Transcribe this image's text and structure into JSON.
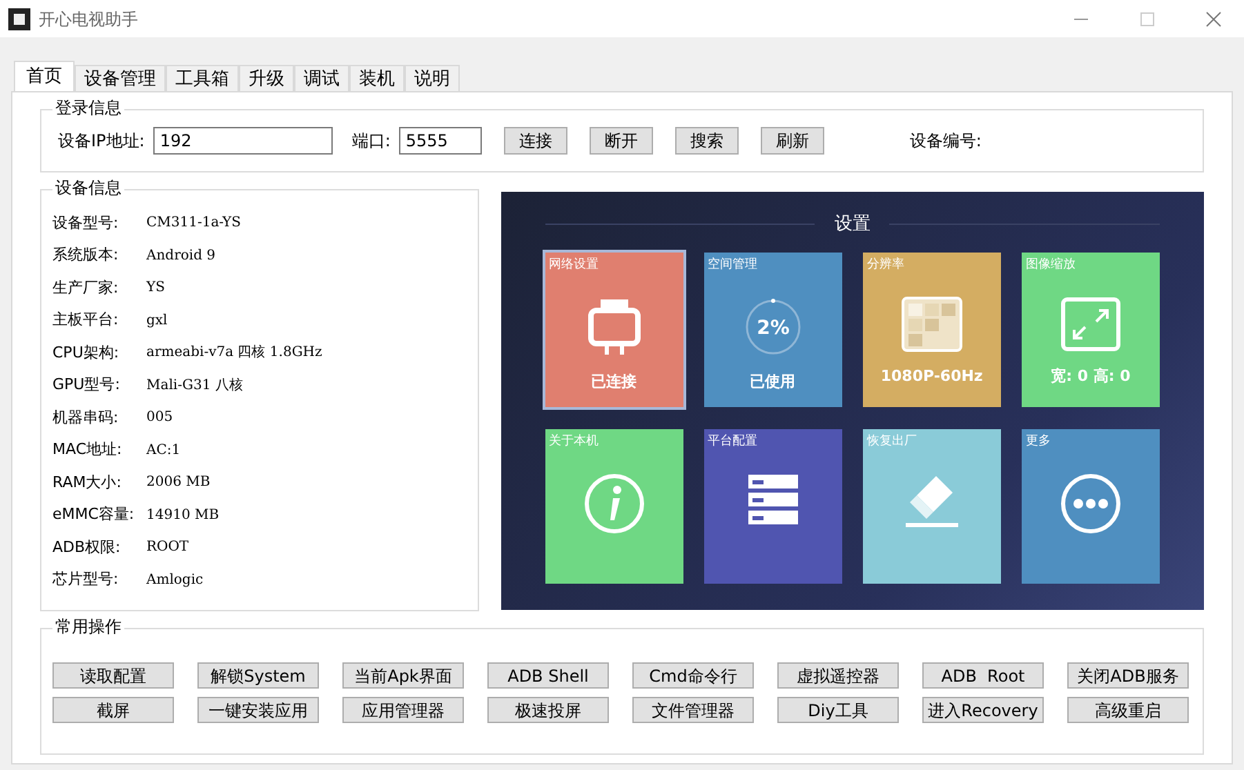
{
  "window": {
    "title": "开心电视助手"
  },
  "tabs": [
    {
      "label": "首页",
      "selected": true
    },
    {
      "label": "设备管理",
      "selected": false
    },
    {
      "label": "工具箱",
      "selected": false
    },
    {
      "label": "升级",
      "selected": false
    },
    {
      "label": "调试",
      "selected": false
    },
    {
      "label": "装机",
      "selected": false
    },
    {
      "label": "说明",
      "selected": false
    }
  ],
  "login": {
    "title": "登录信息",
    "ip_label": "设备IP地址:",
    "ip_value": "192",
    "port_label": "端口:",
    "port_value": "5555",
    "buttons": [
      "连接",
      "断开",
      "搜索",
      "刷新"
    ],
    "device_no_label": "设备编号:"
  },
  "device_info": {
    "title": "设备信息",
    "rows": [
      {
        "label": "设备型号:",
        "value": "CM311-1a-YS"
      },
      {
        "label": "系统版本:",
        "value": "Android 9"
      },
      {
        "label": "生产厂家:",
        "value": "YS"
      },
      {
        "label": "主板平台:",
        "value": "gxl"
      },
      {
        "label": "CPU架构:",
        "value": "armeabi-v7a 四核 1.8GHz"
      },
      {
        "label": "GPU型号:",
        "value": "Mali-G31 八核"
      },
      {
        "label": "机器串码:",
        "value": "005"
      },
      {
        "label": "MAC地址:",
        "value": "AC:1"
      },
      {
        "label": "RAM大小:",
        "value": "2006 MB"
      },
      {
        "label": "eMMC容量:",
        "value": "14910 MB"
      },
      {
        "label": "ADB权限:",
        "value": "ROOT"
      },
      {
        "label": "芯片型号:",
        "value": "Amlogic"
      }
    ]
  },
  "settings_screen": {
    "title": "设置",
    "tiles": [
      {
        "kind": "network",
        "label": "网络设置",
        "caption": "已连接",
        "color": "#e07f6f",
        "selected": true
      },
      {
        "kind": "storage",
        "label": "空间管理",
        "caption": "已使用",
        "gauge": "2%",
        "color": "#4f8fc0",
        "selected": false
      },
      {
        "kind": "resolution",
        "label": "分辨率",
        "caption": "1080P-60Hz",
        "color": "#d4ad62",
        "selected": false
      },
      {
        "kind": "scale",
        "label": "图像缩放",
        "caption": "宽: 0 高: 0",
        "color": "#6fd884",
        "selected": false
      },
      {
        "kind": "info",
        "label": "关于本机",
        "color": "#6fd884",
        "selected": false
      },
      {
        "kind": "config",
        "label": "平台配置",
        "color": "#5055b0",
        "selected": false
      },
      {
        "kind": "reset",
        "label": "恢复出厂",
        "color": "#8acbd8",
        "selected": false
      },
      {
        "kind": "more",
        "label": "更多",
        "color": "#4f8fc0",
        "selected": false
      }
    ]
  },
  "common_ops": {
    "title": "常用操作",
    "buttons": [
      [
        "读取配置",
        "解锁System",
        "当前Apk界面",
        "ADB Shell",
        "Cmd命令行",
        "虚拟遥控器",
        "ADB  Root",
        "关闭ADB服务"
      ],
      [
        "截屏",
        "一键安装应用",
        "应用管理器",
        "极速投屏",
        "文件管理器",
        "Diy工具",
        "进入Recovery",
        "高级重启"
      ]
    ]
  }
}
